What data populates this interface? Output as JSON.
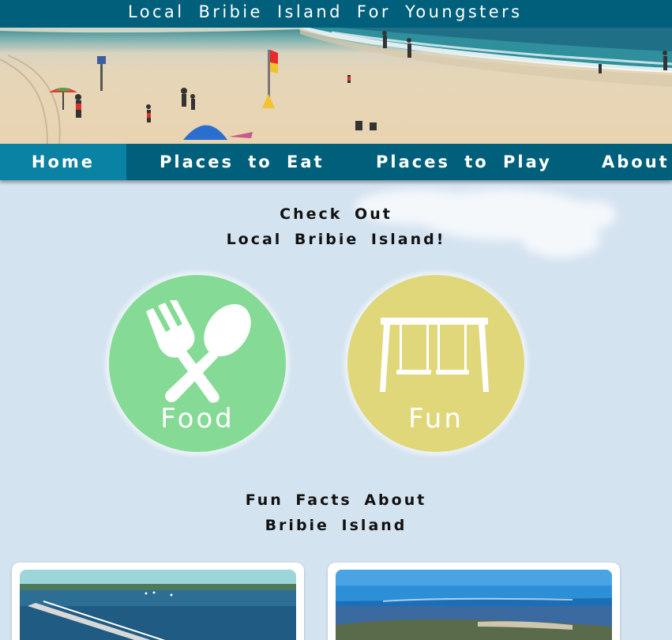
{
  "header": {
    "site_title": "Local Bribie Island For Youngsters"
  },
  "nav": {
    "items": [
      {
        "label": "Home",
        "active": true
      },
      {
        "label": "Places to Eat",
        "active": false
      },
      {
        "label": "Places to Play",
        "active": false
      },
      {
        "label": "About",
        "active": false
      }
    ]
  },
  "intro": {
    "line1": "Check Out",
    "line2": "Local Bribie Island!"
  },
  "categories": {
    "food": {
      "label": "Food",
      "icon": "fork-spoon-icon",
      "color": "#85db95"
    },
    "fun": {
      "label": "Fun",
      "icon": "swing-set-icon",
      "color": "#e0d77a"
    }
  },
  "facts": {
    "line1": "Fun Facts About",
    "line2": "Bribie Island"
  },
  "colors": {
    "bar": "#005f7a",
    "nav_active": "#0a82a4",
    "page_bg": "#d4e3f0"
  }
}
